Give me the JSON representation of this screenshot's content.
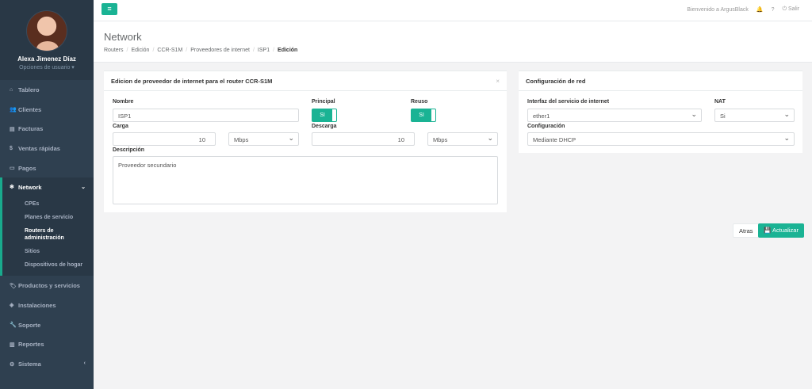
{
  "user": {
    "name": "Alexa Jimenez Díaz",
    "options": "Opciones de usuario ▾"
  },
  "nav": {
    "items": [
      {
        "icon": "⌂",
        "label": "Tablero"
      },
      {
        "icon": "👥",
        "label": "Clientes"
      },
      {
        "icon": "▤",
        "label": "Facturas"
      },
      {
        "icon": "$",
        "label": "Ventas rápidas"
      },
      {
        "icon": "▭",
        "label": "Pagos"
      }
    ],
    "active": {
      "icon": "❄",
      "label": "Network",
      "chevron": "⌄"
    },
    "sub": [
      "CPEs",
      "Planes de servicio",
      "Routers de administración",
      "Sitios",
      "Dispositivos de hogar"
    ],
    "items_after": [
      {
        "icon": "🏷",
        "label": "Productos y servicios"
      },
      {
        "icon": "◈",
        "label": "Instalaciones"
      },
      {
        "icon": "🔧",
        "label": "Soporte"
      },
      {
        "icon": "▥",
        "label": "Reportes"
      },
      {
        "icon": "⚙",
        "label": "Sistema"
      }
    ],
    "sistema_chevron": "‹"
  },
  "topbar": {
    "menu_icon": "≡",
    "welcome": "Bienvenido a ArgusBlack",
    "bell": "🔔",
    "help": "?",
    "logout_icon": "⏻",
    "logout": "Salir"
  },
  "header": {
    "title": "Network",
    "breadcrumb": [
      "Routers",
      "Edición",
      "CCR-S1M",
      "Proveedores de internet",
      "ISP1",
      "Edición"
    ]
  },
  "left_panel": {
    "title": "Edicion de proveedor de internet para el router CCR-S1M",
    "close": "×",
    "nombre_label": "Nombre",
    "nombre_value": "ISP1",
    "principal_label": "Principal",
    "principal_value": "SI",
    "reuso_label": "Reuso",
    "reuso_value": "SI",
    "carga_label": "Carga",
    "carga_value": "10",
    "carga_unit": "Mbps",
    "descarga_label": "Descarga",
    "descarga_value": "10",
    "descarga_unit": "Mbps",
    "descripcion_label": "Descripción",
    "descripcion_value": "Proveedor secundario"
  },
  "right_panel": {
    "title": "Configuración de red",
    "interfaz_label": "Interfaz del servicio de internet",
    "interfaz_value": "ether1",
    "nat_label": "NAT",
    "nat_value": "Si",
    "config_label": "Configuración",
    "config_value": "Mediante DHCP"
  },
  "buttons": {
    "back": "Atras",
    "save": "💾 Actualizar"
  },
  "colors": {
    "accent": "#1ab394",
    "sidebar": "#2f4050"
  }
}
